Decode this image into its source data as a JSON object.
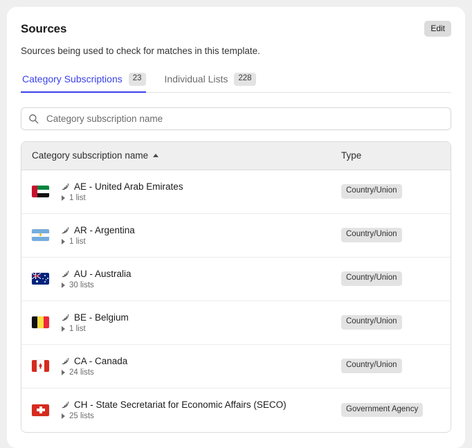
{
  "header": {
    "title": "Sources",
    "subtitle": "Sources being used to check for matches in this template.",
    "edit_label": "Edit"
  },
  "tabs": [
    {
      "label": "Category Subscriptions",
      "badge": "23",
      "active": true
    },
    {
      "label": "Individual Lists",
      "badge": "228",
      "active": false
    }
  ],
  "search": {
    "placeholder": "Category subscription name",
    "value": "",
    "icon": "search-icon"
  },
  "table": {
    "columns": [
      {
        "label": "Category subscription name",
        "sort": "ascending"
      },
      {
        "label": "Type"
      }
    ],
    "rows": [
      {
        "flag": "ae",
        "icon": "rss-icon",
        "name": "AE - United Arab Emirates",
        "lists": "1 list",
        "type": "Country/Union"
      },
      {
        "flag": "ar",
        "icon": "rss-icon",
        "name": "AR - Argentina",
        "lists": "1 list",
        "type": "Country/Union"
      },
      {
        "flag": "au",
        "icon": "rss-icon",
        "name": "AU - Australia",
        "lists": "30 lists",
        "type": "Country/Union"
      },
      {
        "flag": "be",
        "icon": "rss-icon",
        "name": "BE - Belgium",
        "lists": "1 list",
        "type": "Country/Union"
      },
      {
        "flag": "ca",
        "icon": "rss-icon",
        "name": "CA - Canada",
        "lists": "24 lists",
        "type": "Country/Union"
      },
      {
        "flag": "ch",
        "icon": "rss-icon",
        "name": "CH - State Secretariat for Economic Affairs (SECO)",
        "lists": "25 lists",
        "type": "Government Agency"
      }
    ]
  },
  "colors": {
    "accent": "#3a41e8",
    "page_bg": "#f0eff0",
    "card_bg": "#ffffff",
    "badge_bg": "#e3e3e3",
    "header_row_bg": "#efefef"
  }
}
